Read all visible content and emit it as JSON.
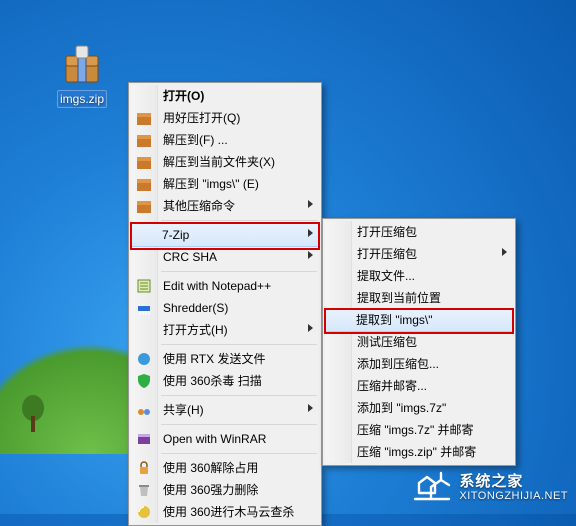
{
  "desktop": {
    "file_label": "imgs.zip"
  },
  "menu1": {
    "open": "打开(O)",
    "haozip_open": "用好压打开(Q)",
    "extract_to": "解压到(F) ...",
    "extract_here": "解压到当前文件夹(X)",
    "extract_to_imgs": "解压到 \"imgs\\\" (E)",
    "other_archive": "其他压缩命令",
    "seven_zip": "7-Zip",
    "crc_sha": "CRC SHA",
    "edit_npp": "Edit with Notepad++",
    "shredder": "Shredder(S)",
    "open_with": "打开方式(H)",
    "rtx_send": "使用 RTX 发送文件",
    "sav360": "使用 360杀毒 扫描",
    "share": "共享(H)",
    "open_winrar": "Open with WinRAR",
    "occupy360": "使用 360解除占用",
    "force_del360": "使用 360强力删除",
    "cloud_check360": "使用 360进行木马云查杀"
  },
  "menu2": {
    "open_archive": "打开压缩包",
    "open_archive_sub": "打开压缩包",
    "extract_files": "提取文件...",
    "extract_here": "提取到当前位置",
    "extract_to_imgs": "提取到 \"imgs\\\"",
    "test_archive": "测试压缩包",
    "add_to_archive": "添加到压缩包...",
    "compress_mail": "压缩并邮寄...",
    "add_to_7z": "添加到 \"imgs.7z\"",
    "compress_7z_mail": "压缩 \"imgs.7z\" 并邮寄",
    "compress_zip_mail": "压缩 \"imgs.zip\" 并邮寄"
  },
  "watermark": {
    "title": "系统之家",
    "url": "XITONGZHIJIA.NET"
  }
}
